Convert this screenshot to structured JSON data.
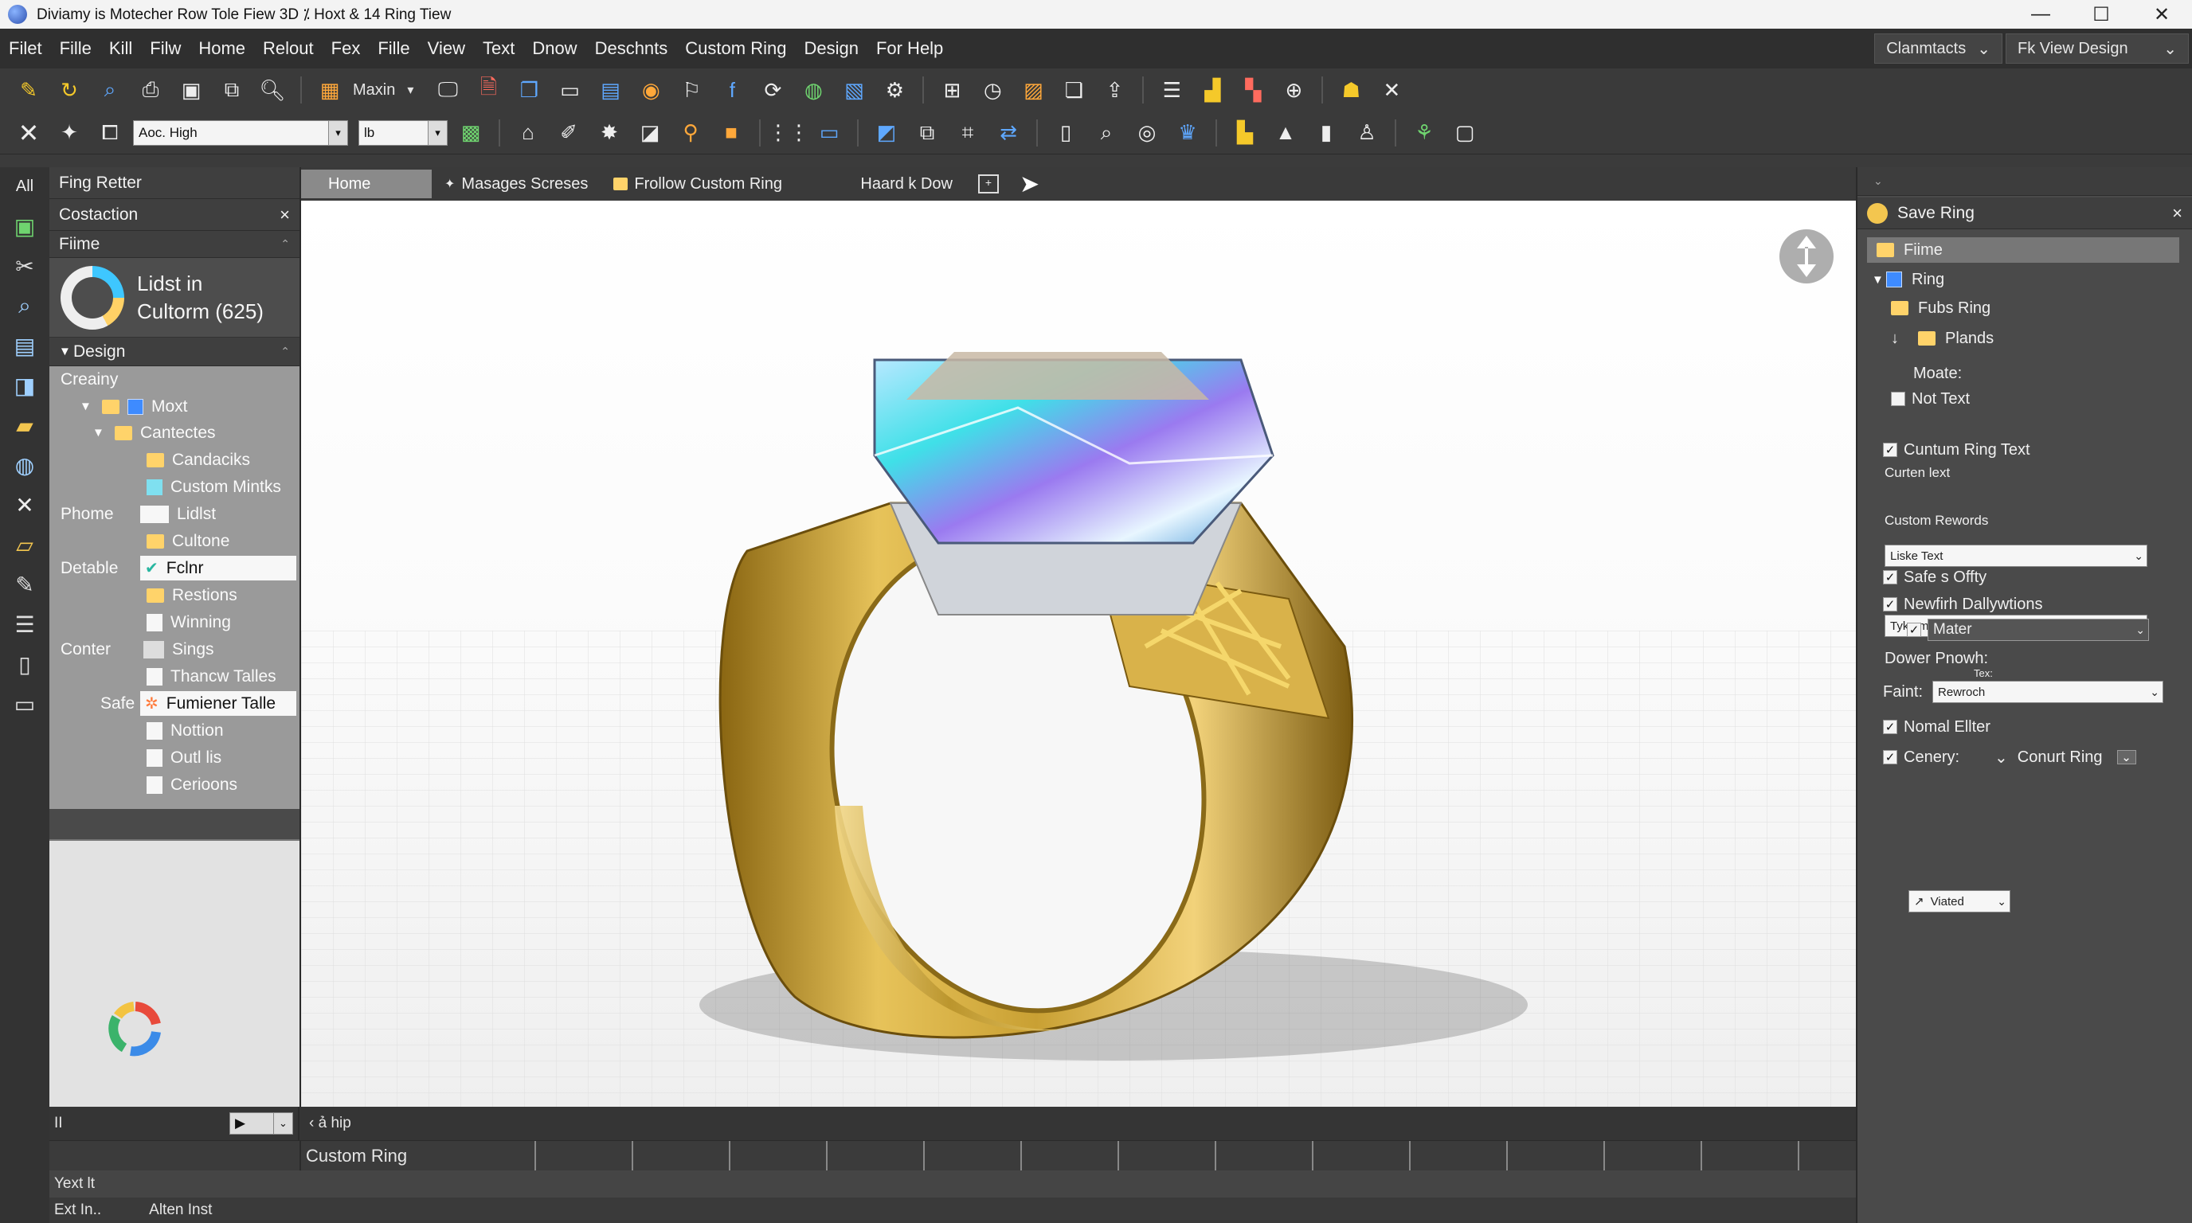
{
  "window": {
    "title": "Diviamy is Motecher Row Tole Fiew 3D ⁒ Hoxt & 14 Ring Tiew",
    "controls": [
      "—",
      "☐",
      "✕"
    ]
  },
  "menu": {
    "items": [
      "Filet",
      "Fille",
      "Kill",
      "Filw",
      "Home",
      "Relout",
      "Fex",
      "Fille",
      "View",
      "Text",
      "Dnow",
      "Deschnts",
      "Custom Ring",
      "Design",
      "For Help"
    ],
    "right": {
      "contacts": "Clanmtacts",
      "view_design": "Fk View Design"
    }
  },
  "toolbar": {
    "font_combo": "Aoc. High",
    "size_combo": "lb",
    "maxin_label": "Maxin"
  },
  "left_panel": {
    "top_header": "Fing Retter",
    "section_header": "Costaction",
    "sub_header": "Fiime",
    "stat": {
      "line1": "Lidst in",
      "line2": "Cultorm (625)"
    },
    "design_header": "Design",
    "tree": [
      {
        "group": "Creainy",
        "label": ""
      },
      {
        "group": "",
        "label": "Moxt"
      },
      {
        "group": "",
        "label": "Cantectes"
      },
      {
        "group": "",
        "label": "Candaciks"
      },
      {
        "group": "",
        "label": "Custom Mintks"
      },
      {
        "group": "Phome",
        "label": "Lidlst"
      },
      {
        "group": "",
        "label": "Cultone"
      },
      {
        "group": "Detable",
        "label": "Fclnr"
      },
      {
        "group": "",
        "label": "Restions"
      },
      {
        "group": "",
        "label": "Winning"
      },
      {
        "group": "Conter",
        "label": "Sings"
      },
      {
        "group": "",
        "label": "Thancw Talles"
      },
      {
        "group": "Safe",
        "label": "Fumiener Talle"
      },
      {
        "group": "",
        "label": "Nottion"
      },
      {
        "group": "",
        "label": "Outl lis"
      },
      {
        "group": "",
        "label": "Cerioons"
      }
    ],
    "left_label": "All"
  },
  "tabs": [
    {
      "label": "Home"
    },
    {
      "label": "Masages Screses"
    },
    {
      "label": "Frollow Custom Ring"
    },
    {
      "label": "Haard k Dow"
    }
  ],
  "right_panel": {
    "title": "Save Ring",
    "tree": [
      "Fiime",
      "Ring",
      "Fubs Ring",
      "Plands"
    ],
    "moate": "Moate:",
    "not_text": "Not Text",
    "section": "Cuntum Ring Text",
    "curten_label": "Curten lext",
    "curten_value": "Liske Text",
    "rewords_label": "Custom Rewords",
    "rewords_value": "Tyke mages",
    "safe": "Safe s Offty",
    "newfirh": "Newfirh Dallywtions",
    "mater": "Mater",
    "dower": "Dower Pnowh:",
    "tex": "Tex:",
    "faint_label": "Faint:",
    "faint_value": "Rewroch",
    "nomal": "Nomal Ellter",
    "cenery": "Cenery:",
    "conurt": "Conurt Ring",
    "viated": "Viated"
  },
  "bottom": {
    "field1": "II",
    "hip": "ả hip",
    "custom_ring": "Custom Ring",
    "yext": "Yext lt",
    "status1": "Ext In..",
    "status2": "Alten Inst"
  }
}
